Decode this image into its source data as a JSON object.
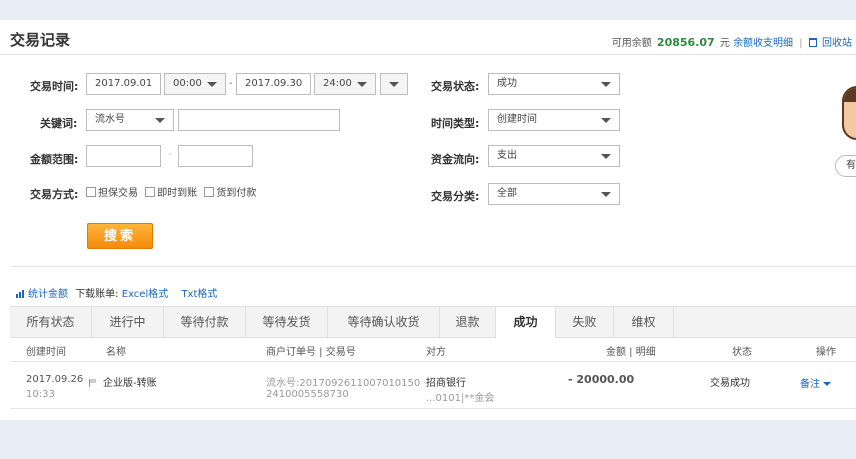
{
  "header": {
    "title": "交易记录",
    "balance_label": "可用余额",
    "balance_amount": "20856.07",
    "balance_unit": "元",
    "detail_link": "余额收支明细",
    "recycle_link": "回收站",
    "recycle_icon": "trash-icon"
  },
  "filters": {
    "time_label": "交易时间:",
    "date_start": "2017.09.01",
    "time_start": "00:00",
    "date_end": "2017.09.30",
    "time_end": "24:00",
    "range_dash": "-",
    "keyword_label": "关键词:",
    "keyword_type": "流水号",
    "keyword_value": "",
    "amount_label": "金额范围:",
    "amount_min": "",
    "amount_max": "",
    "amount_dash": "-",
    "method_label": "交易方式:",
    "methods": [
      "担保交易",
      "即时到账",
      "货到付款"
    ],
    "status_label": "交易状态:",
    "status_value": "成功",
    "time_type_label": "时间类型:",
    "time_type_value": "创建时间",
    "flow_label": "资金流向:",
    "flow_value": "支出",
    "category_label": "交易分类:",
    "category_value": "全部",
    "search_button": "搜索"
  },
  "tools": {
    "stats_icon": "bar-chart-icon",
    "stats_link": "统计金额",
    "download_label": "下载账单:",
    "excel_link": "Excel格式",
    "txt_link": "Txt格式"
  },
  "tabs": [
    "所有状态",
    "进行中",
    "等待付款",
    "等待发货",
    "等待确认收货",
    "退款",
    "成功",
    "失败",
    "维权"
  ],
  "active_tab": "成功",
  "table": {
    "headers": {
      "created": "创建时间",
      "name": "名称",
      "order_no": "商户订单号 | 交易号",
      "counterparty": "对方",
      "amount": "金额 | 明细",
      "status": "状态",
      "action": "操作"
    },
    "rows": [
      {
        "date": "2017.09.26",
        "time": "10:33",
        "name": "企业版-转账",
        "serial": "流水号:2017092611007010150",
        "serial2": "2410005558730",
        "party": "招商银行",
        "party_acct": "...0101|**金会",
        "amount": "- 20000.00",
        "status": "交易成功",
        "action": "备注"
      }
    ]
  },
  "side": {
    "pill_text": "有"
  }
}
